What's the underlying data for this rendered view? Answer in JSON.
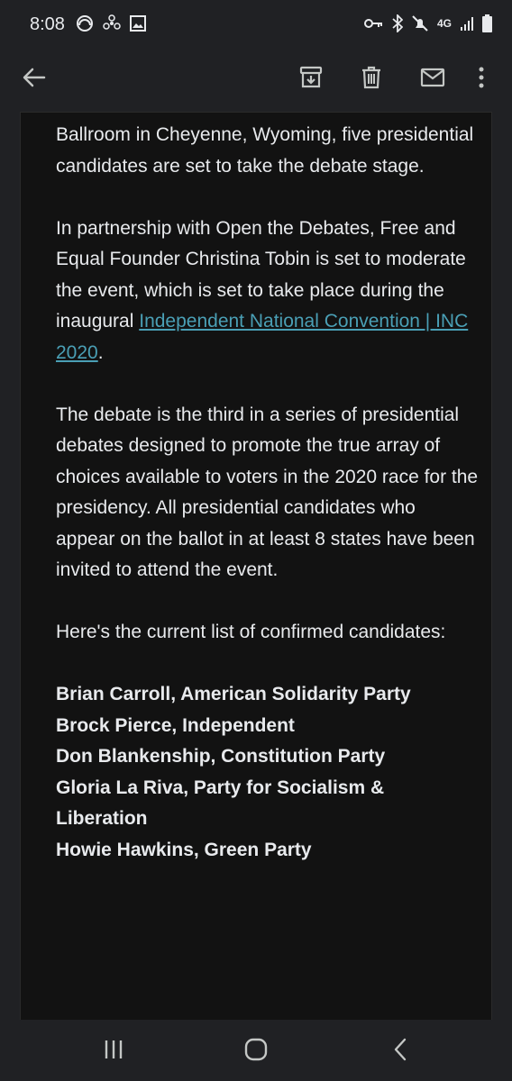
{
  "status_bar": {
    "time": "8:08",
    "network_label": "4G",
    "left_icons": [
      "hotspot-icon",
      "fan-icon",
      "image-icon"
    ],
    "right_icons": [
      "key-icon",
      "bluetooth-icon",
      "mute-icon",
      "network-4g-icon",
      "signal-icon",
      "battery-icon"
    ]
  },
  "toolbar": {
    "back_icon": "arrow-left-icon",
    "archive_icon": "archive-icon",
    "delete_icon": "trash-icon",
    "mark_unread_icon": "envelope-icon",
    "more_icon": "more-vertical-icon"
  },
  "email": {
    "para1": "Ballroom in Cheyenne, Wyoming, five presidential candidates are set to take the debate stage.",
    "para2_text": "In partnership with Open the Debates, Free and Equal Founder Christina Tobin is set to moderate the event, which is set to  take place during the inaugural ",
    "para2_link": "Independent National Convention | INC 2020",
    "para2_end": ".",
    "para3": "The debate is the third in a series of presidential debates designed to promote the true array of choices available to voters in the 2020 race for the presidency. All presidential candidates who appear on the ballot in at least 8 states have been invited to attend the event.",
    "para4": "Here's the current list of confirmed candidates:",
    "candidates": [
      "Brian Carroll, American Solidarity Party",
      "Brock Pierce, Independent",
      "Don Blankenship, Constitution Party",
      "Gloria La Riva, Party for Socialism & Liberation",
      "Howie Hawkins, Green Party"
    ]
  },
  "nav_bar": {
    "recents_icon": "recents-icon",
    "home_icon": "home-icon",
    "back_icon": "nav-back-icon"
  },
  "colors": {
    "background": "#202124",
    "email_background": "#121212",
    "text": "#e8eaed",
    "link": "#4a9fb5"
  }
}
